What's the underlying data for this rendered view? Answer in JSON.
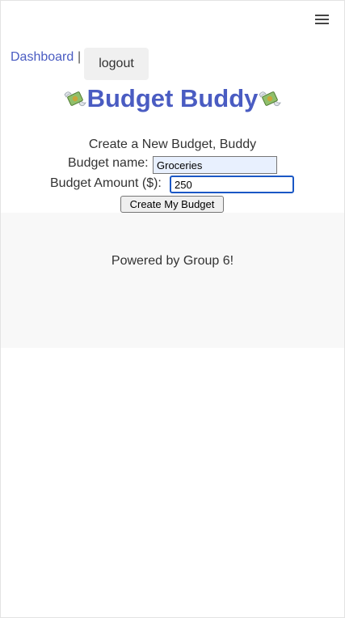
{
  "nav": {
    "dashboard_link": "Dashboard",
    "separator": "|",
    "logout_label": "logout"
  },
  "header": {
    "title": "Budget Buddy",
    "emoji_icon": "money-with-wings-icon"
  },
  "form": {
    "heading": "Create a New Budget, Buddy",
    "budget_name_label": "Budget name:",
    "budget_name_value": "Groceries",
    "budget_amount_label": "Budget Amount ($):",
    "budget_amount_value": "250",
    "submit_label": "Create My Budget"
  },
  "footer": {
    "text": "Powered by Group 6!"
  },
  "colors": {
    "accent": "#4a5cc2",
    "footer_bg": "#f8f8f8",
    "focus_border": "#1a57c5"
  }
}
